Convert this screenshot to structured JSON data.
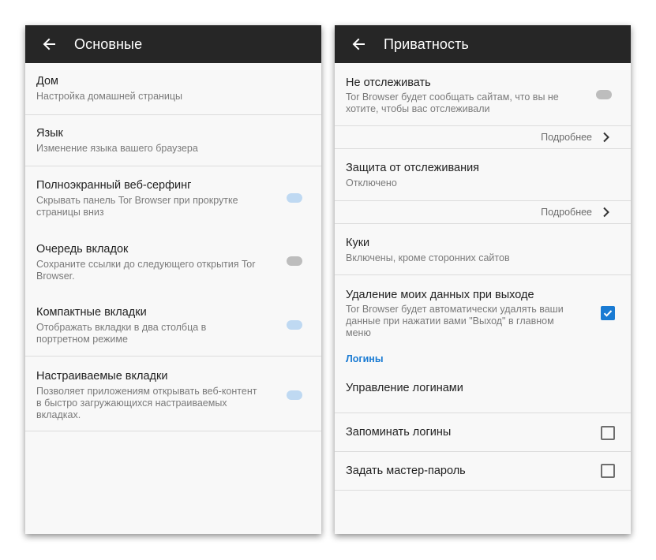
{
  "left": {
    "title": "Основные",
    "items": [
      {
        "title": "Дом",
        "summary": "Настройка домашней страницы"
      },
      {
        "title": "Язык",
        "summary": "Изменение языка вашего браузера"
      },
      {
        "title": "Полноэкранный веб-серфинг",
        "summary1": "Скрывать панель Tor Browser при прокрутке",
        "summary2": "страницы вниз",
        "switch": "on"
      },
      {
        "title": "Очередь вкладок",
        "summary1": "Сохраните ссылки до следующего открытия Tor",
        "summary2": "Browser.",
        "switch": "off"
      },
      {
        "title": "Компактные вкладки",
        "summary1": "Отображать вкладки в два столбца в",
        "summary2": "портретном режиме",
        "switch": "on"
      },
      {
        "title": "Настраиваемые вкладки",
        "summary1": "Позволяет приложениям открывать веб-контент",
        "summary2": "в быстро загружающихся настраиваемых",
        "summary3": "вкладках.",
        "switch": "on"
      }
    ]
  },
  "right": {
    "title": "Приватность",
    "dnt": {
      "title": "Не отслеживать",
      "summary1": "Tor Browser будет сообщать сайтам, что вы не",
      "summary2": "хотите, чтобы вас отслеживали",
      "switch": "off"
    },
    "more1": "Подробнее",
    "tracking": {
      "title": "Защита от отслеживания",
      "summary": "Отключено"
    },
    "more2": "Подробнее",
    "cookies": {
      "title": "Куки",
      "summary": "Включены, кроме сторонних сайтов"
    },
    "clear": {
      "title": "Удаление моих данных при выходе",
      "summary1": "Tor Browser будет автоматически удалять ваши",
      "summary2": "данные при нажатии вами \"Выход\" в главном",
      "summary3": "меню",
      "checked": true
    },
    "section": "Логины",
    "manage": "Управление логинами",
    "remember": {
      "title": "Запоминать логины",
      "checked": false
    },
    "master": {
      "title": "Задать мастер-пароль",
      "checked": false
    }
  },
  "colors": {
    "toolbar": "#262626",
    "accent": "#1a7bd3",
    "switch_on": "#bfd9f2",
    "switch_off": "#bdbdbd"
  },
  "icons": [
    "back-arrow-icon",
    "chevron-right-icon",
    "checkmark-icon"
  ]
}
